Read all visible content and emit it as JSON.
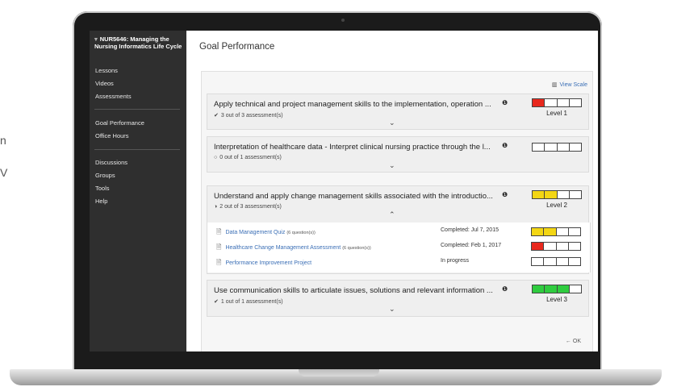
{
  "backdrop": {
    "fragment_1": "n",
    "fragment_2": "V"
  },
  "sidebar": {
    "course_title": "NUR5646: Managing the Nursing Informatics Life Cycle",
    "items_top": [
      "Lessons",
      "Videos",
      "Assessments"
    ],
    "items_mid": [
      "Goal Performance",
      "Office Hours"
    ],
    "items_bottom": [
      "Discussions",
      "Groups",
      "Tools",
      "Help"
    ]
  },
  "page": {
    "title": "Goal Performance",
    "view_scale": "View Scale",
    "ok_label": "OK"
  },
  "goals": [
    {
      "title": "Apply technical and project management skills to the implementation, operation ...",
      "count": "3 out of 3 assessment(s)",
      "status_icon": "check-circle-icon",
      "level": "Level 1",
      "meter": [
        "#e8281d",
        "#ffffff",
        "#ffffff",
        "#ffffff"
      ],
      "expanded": false
    },
    {
      "title": "Interpretation of healthcare data - Interpret clinical nursing practice through the l...",
      "count": "0 out of 1 assessment(s)",
      "status_icon": "empty-circle-icon",
      "level": "",
      "meter": [
        "#ffffff",
        "#ffffff",
        "#ffffff",
        "#ffffff"
      ],
      "expanded": false
    },
    {
      "title": "Understand and apply change management skills associated with the introductio...",
      "count": "2 out of 3 assessment(s)",
      "status_icon": "half-circle-icon",
      "level": "Level 2",
      "meter": [
        "#f3d614",
        "#f3d614",
        "#ffffff",
        "#ffffff"
      ],
      "expanded": true,
      "assessments": [
        {
          "name": "Data Management Quiz",
          "detail": "(6 question(s))",
          "status": "Completed: Jul 7, 2015",
          "meter": [
            "#f3d614",
            "#f3d614",
            "#ffffff",
            "#ffffff"
          ]
        },
        {
          "name": "Healthcare Change Management Assessment",
          "detail": "(6 question(s))",
          "status": "Completed: Feb 1, 2017",
          "meter": [
            "#e8281d",
            "#ffffff",
            "#ffffff",
            "#ffffff"
          ]
        },
        {
          "name": "Performance Improvement Project",
          "detail": "",
          "status": "In progress",
          "meter": [
            "#ffffff",
            "#ffffff",
            "#ffffff",
            "#ffffff"
          ]
        }
      ]
    },
    {
      "title": "Use communication skills to articulate issues, solutions and relevant information ...",
      "count": "1 out of 1 assessment(s)",
      "status_icon": "check-circle-icon",
      "level": "Level 3",
      "meter": [
        "#2fcc3f",
        "#2fcc3f",
        "#2fcc3f",
        "#ffffff"
      ],
      "expanded": false
    }
  ]
}
